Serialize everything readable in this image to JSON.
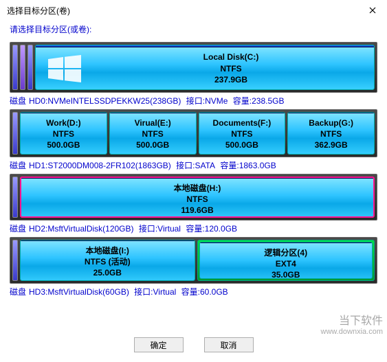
{
  "title": "选择目标分区(卷)",
  "prompt": "请选择目标分区(或卷):",
  "disks": [
    {
      "stubs": 3,
      "partitions": [
        {
          "name": "Local Disk(C:)",
          "fs": "NTFS",
          "size": "237.9GB",
          "winlogo": true
        }
      ],
      "info": {
        "label": "磁盘",
        "model": "HD0:NVMeINTELSSDPEKKW25(238GB)",
        "iface_label": "接口:",
        "iface": "NVMe",
        "cap_label": "容量:",
        "cap": "238.5GB"
      }
    },
    {
      "stubs": 1,
      "partitions": [
        {
          "name": "Work(D:)",
          "fs": "NTFS",
          "size": "500.0GB"
        },
        {
          "name": "Virual(E:)",
          "fs": "NTFS",
          "size": "500.0GB"
        },
        {
          "name": "Documents(F:)",
          "fs": "NTFS",
          "size": "500.0GB"
        },
        {
          "name": "Backup(G:)",
          "fs": "NTFS",
          "size": "362.9GB"
        }
      ],
      "info": {
        "label": "磁盘",
        "model": "HD1:ST2000DM008-2FR102(1863GB)",
        "iface_label": "接口:",
        "iface": "SATA",
        "cap_label": "容量:",
        "cap": "1863.0GB"
      }
    },
    {
      "stubs": 1,
      "partitions": [
        {
          "name": "本地磁盘(H:)",
          "fs": "NTFS",
          "size": "119.6GB",
          "selected": true
        }
      ],
      "info": {
        "label": "磁盘",
        "model": "HD2:MsftVirtualDisk(120GB)",
        "iface_label": "接口:",
        "iface": "Virtual",
        "cap_label": "容量:",
        "cap": "120.0GB"
      }
    },
    {
      "stubs": 1,
      "partitions": [
        {
          "name": "本地磁盘(I:)",
          "fs": "NTFS (活动)",
          "size": "25.0GB"
        },
        {
          "name": "逻辑分区(4)",
          "fs": "EXT4",
          "size": "35.0GB",
          "extended": true,
          "magenta": true
        }
      ],
      "info": {
        "label": "磁盘",
        "model": "HD3:MsftVirtualDisk(60GB)",
        "iface_label": "接口:",
        "iface": "Virtual",
        "cap_label": "容量:",
        "cap": "60.0GB"
      }
    }
  ],
  "buttons": {
    "ok": "确定",
    "cancel": "取消"
  },
  "watermark": {
    "line1": "当下软件",
    "line2": "www.downxia.com"
  }
}
